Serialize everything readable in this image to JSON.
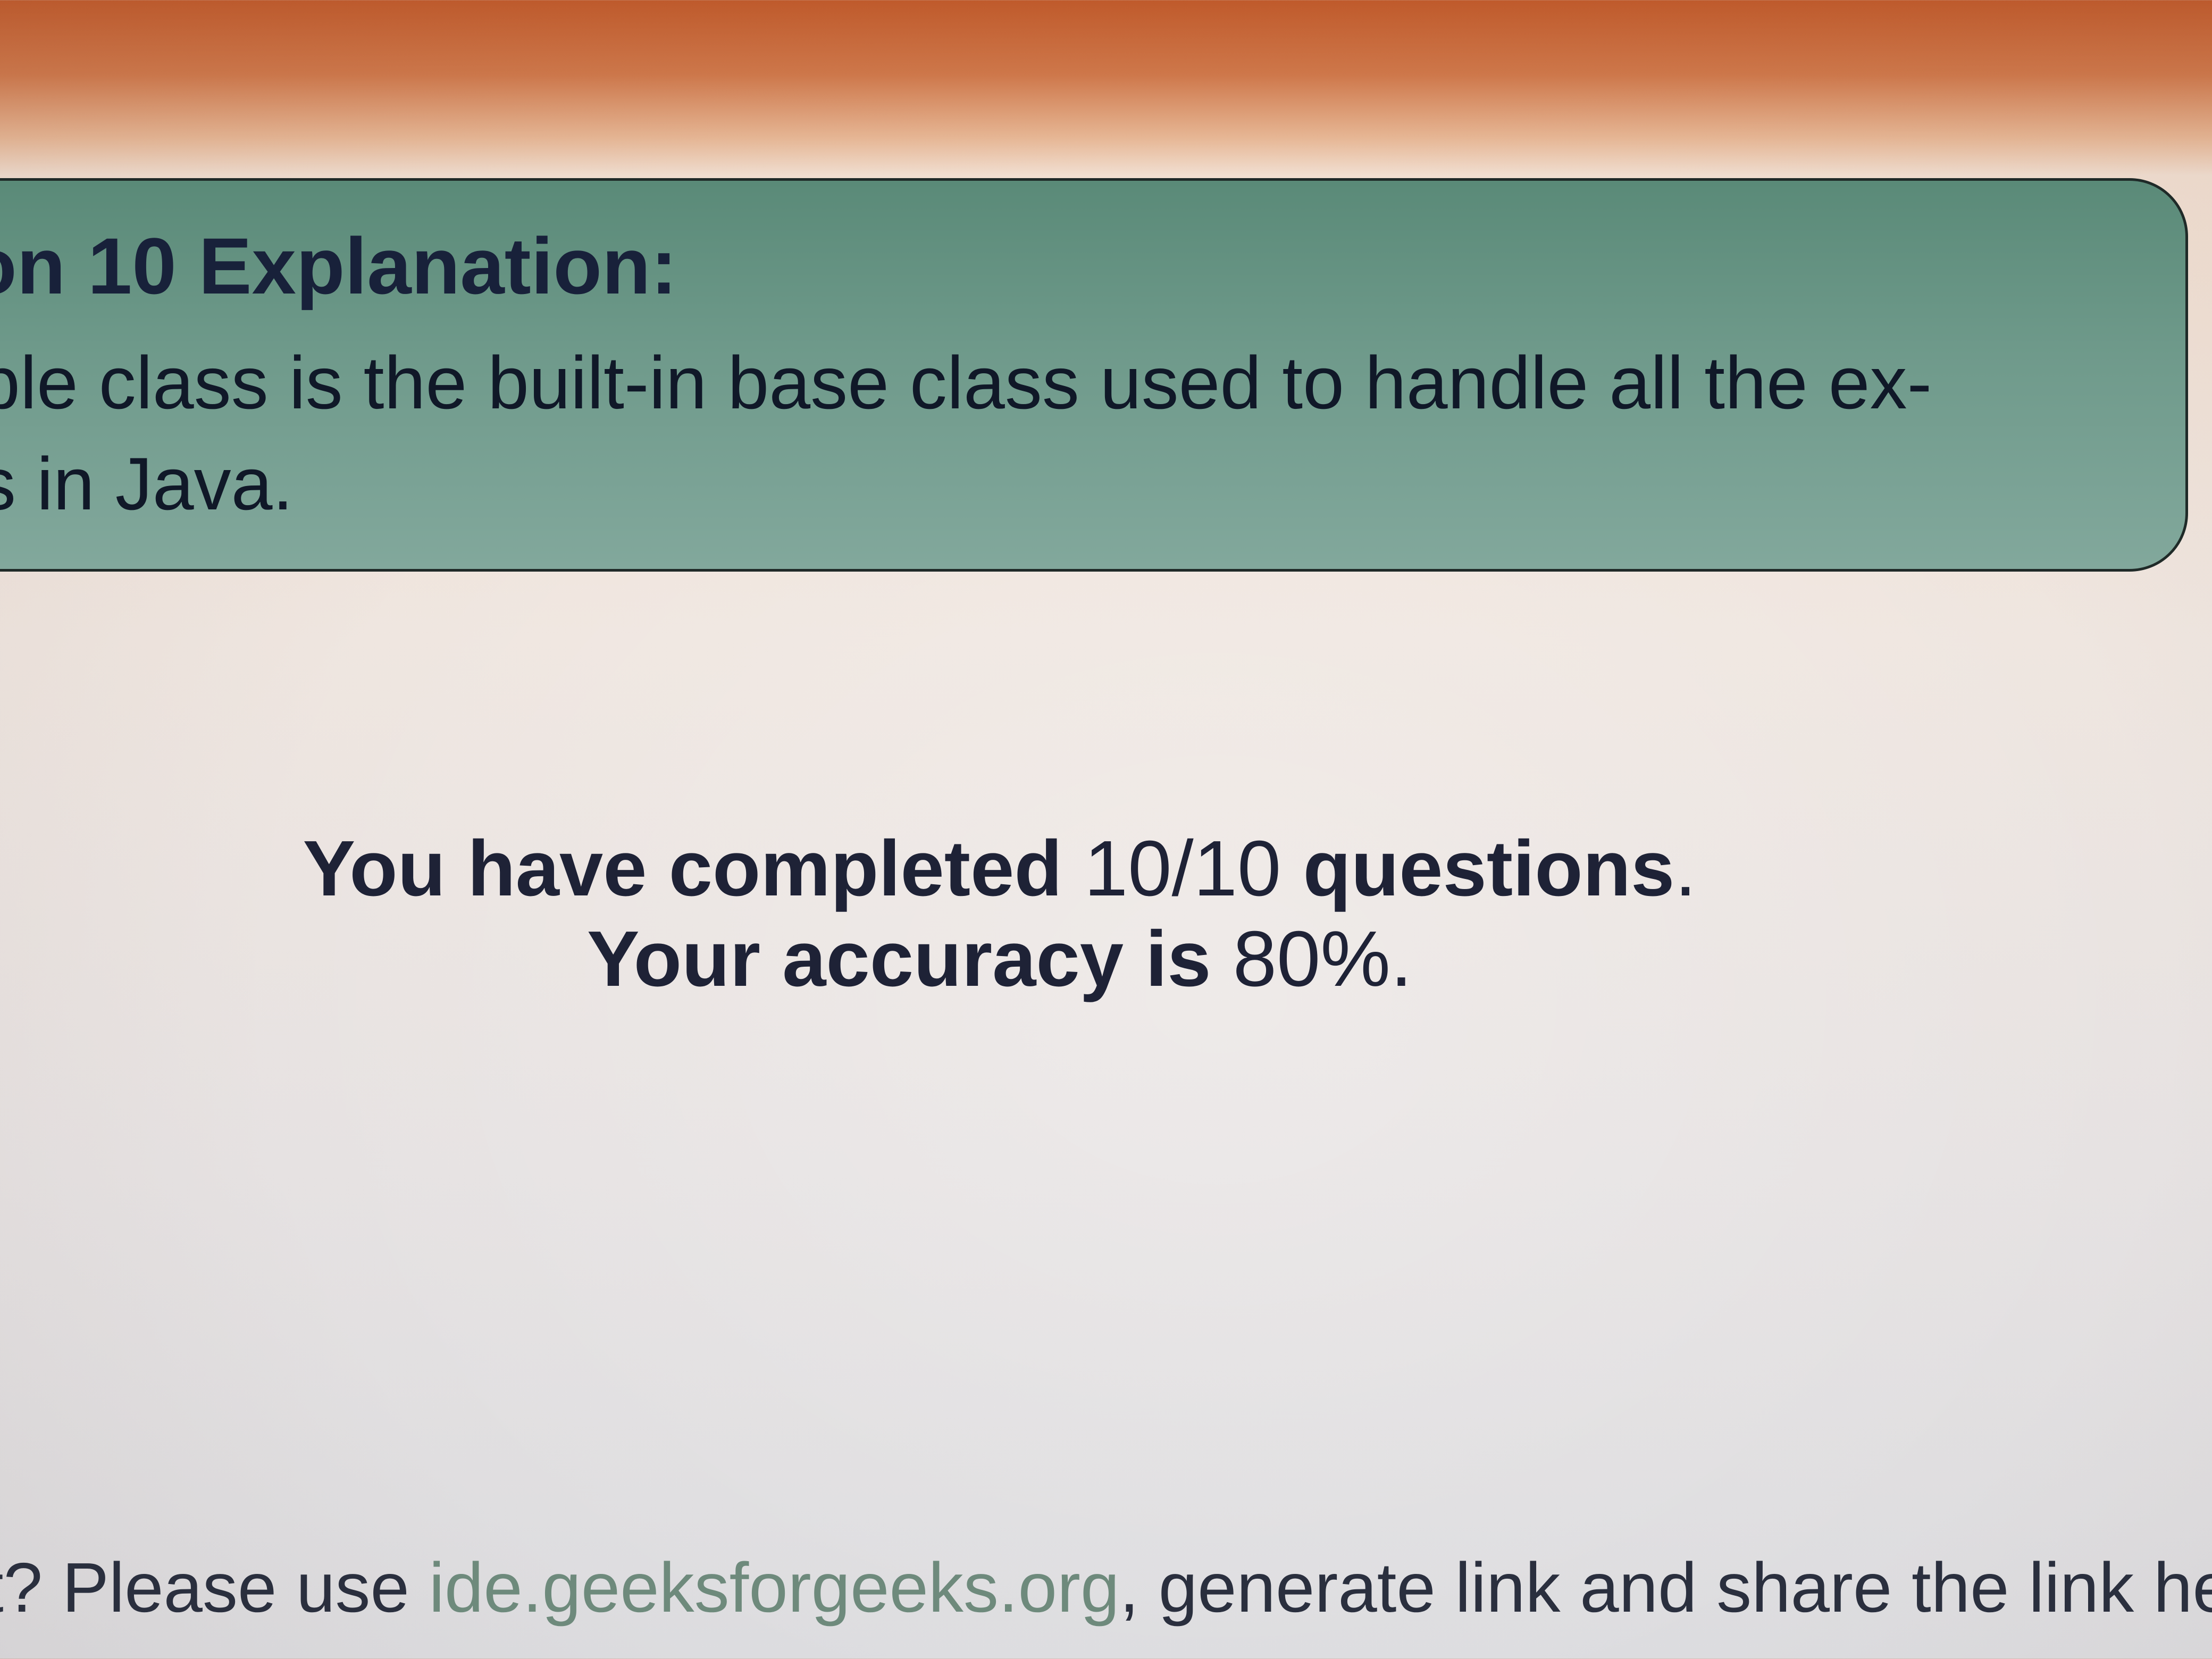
{
  "explanation": {
    "title": "on 10 Explanation:",
    "line1": "ble class is the built-in base class used to handle all the ex-",
    "line2": "s in Java."
  },
  "result": {
    "completed_prefix": "You have completed",
    "completed_value": "10/10",
    "completed_suffix": "questions",
    "completed_end": ".",
    "accuracy_prefix": "Your accuracy is",
    "accuracy_value": "80%",
    "accuracy_end": "."
  },
  "footer": {
    "prefix": "t? Please use",
    "link": "ide.geeksforgeeks.org",
    "suffix": ", generate link and share the link here."
  },
  "colors": {
    "explanation_bg": "#6f9a8b",
    "link": "#6e8a7c",
    "text": "#1e2236"
  }
}
